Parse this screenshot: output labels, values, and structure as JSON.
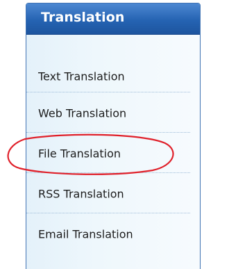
{
  "panel": {
    "title": "Translation",
    "items": [
      {
        "label": "Text Translation"
      },
      {
        "label": "Web Translation"
      },
      {
        "label": "File Translation"
      },
      {
        "label": "RSS Translation"
      },
      {
        "label": "Email Translation"
      }
    ],
    "highlighted_item": "File Translation"
  },
  "colors": {
    "header_blue": "#2563b2",
    "panel_background": "#eef7fc",
    "highlight_circle": "#e0202a",
    "text": "#1c1c1c"
  }
}
